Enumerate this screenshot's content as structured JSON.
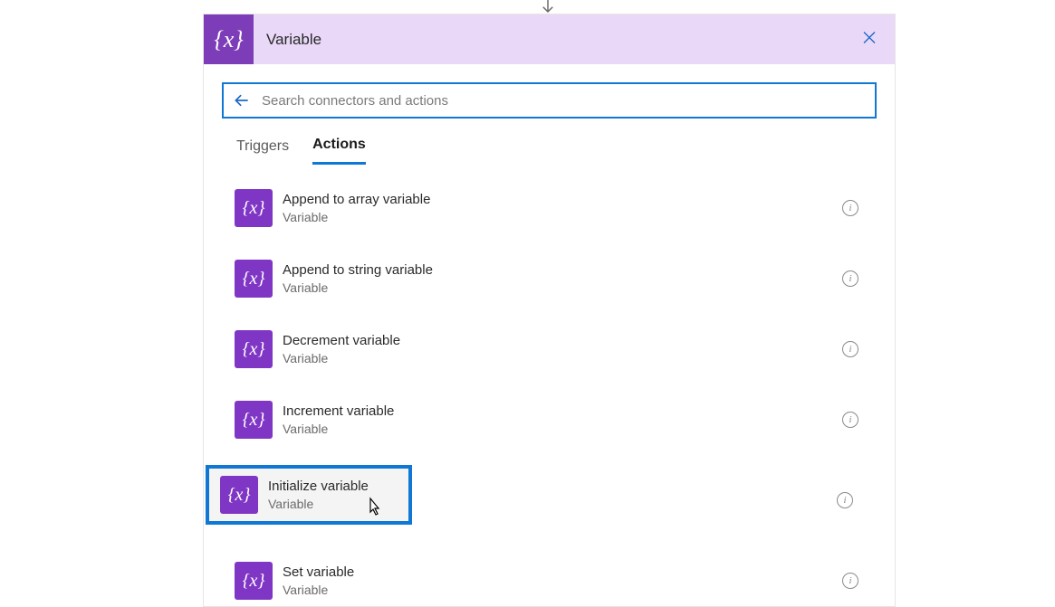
{
  "header": {
    "icon_text": "{x}",
    "title": "Variable"
  },
  "search": {
    "placeholder": "Search connectors and actions",
    "value": ""
  },
  "tabs": [
    {
      "label": "Triggers",
      "active": false
    },
    {
      "label": "Actions",
      "active": true
    }
  ],
  "actions": [
    {
      "title": "Append to array variable",
      "subtitle": "Variable",
      "highlighted": false
    },
    {
      "title": "Append to string variable",
      "subtitle": "Variable",
      "highlighted": false
    },
    {
      "title": "Decrement variable",
      "subtitle": "Variable",
      "highlighted": false
    },
    {
      "title": "Increment variable",
      "subtitle": "Variable",
      "highlighted": false
    },
    {
      "title": "Initialize variable",
      "subtitle": "Variable",
      "highlighted": true
    },
    {
      "title": "Set variable",
      "subtitle": "Variable",
      "highlighted": false
    }
  ],
  "icon_glyph": "{x}",
  "colors": {
    "accent": "#1078d4",
    "connector": "#8036c5",
    "header_bg": "#e9d8f7"
  }
}
